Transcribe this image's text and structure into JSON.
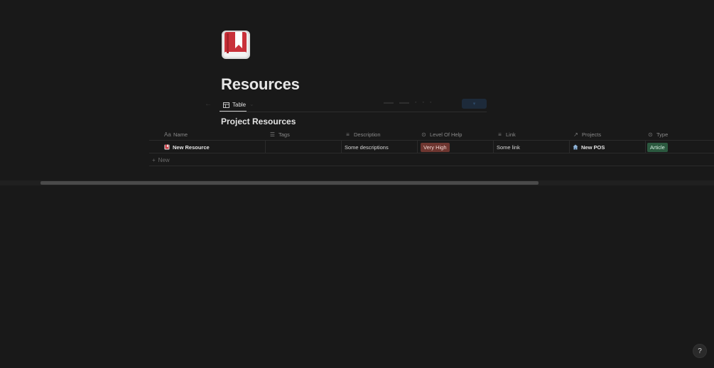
{
  "page": {
    "title": "Resources",
    "icon": "red-bookmark-book-icon"
  },
  "viewbar": {
    "active_tab": "Table"
  },
  "database": {
    "title": "Project Resources",
    "columns": [
      {
        "label": "Name",
        "icon": "Aa"
      },
      {
        "label": "Tags",
        "icon": "list-icon"
      },
      {
        "label": "Description",
        "icon": "text-lines-icon"
      },
      {
        "label": "Level Of Help",
        "icon": "select-circle-icon"
      },
      {
        "label": "Link",
        "icon": "text-lines-icon"
      },
      {
        "label": "Projects",
        "icon": "relation-arrow-icon"
      },
      {
        "label": "Type",
        "icon": "select-circle-icon"
      }
    ],
    "rows": [
      {
        "name": "New Resource",
        "tags": "",
        "description": "Some descriptions",
        "level_of_help": "Very High",
        "link": "Some link",
        "projects": "New POS",
        "type": "Article"
      }
    ],
    "new_label": "New"
  },
  "colors": {
    "background": "#191919",
    "tag_very_high": "#6e3630",
    "tag_article": "#2b593f"
  },
  "help_label": "?"
}
